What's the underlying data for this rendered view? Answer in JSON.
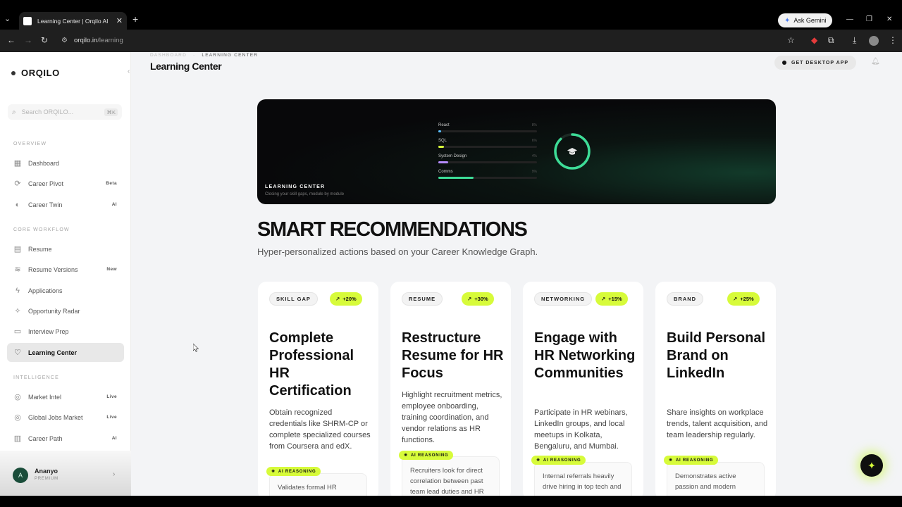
{
  "browser": {
    "tab_title": "Learning Center | Orqilo AI",
    "url_host": "orqilo.in",
    "url_path": "/learning",
    "ask_gemini": "Ask Gemini"
  },
  "sidebar": {
    "brand": "ORQILO",
    "search_placeholder": "Search ORQILO...",
    "search_shortcut": "⌘K",
    "sections": {
      "overview": "OVERVIEW",
      "core": "CORE WORKFLOW",
      "intelligence": "INTELLIGENCE"
    },
    "items": [
      {
        "label": "Dashboard",
        "badge": ""
      },
      {
        "label": "Career Pivot",
        "badge": "Beta"
      },
      {
        "label": "Career Twin",
        "badge": "AI"
      },
      {
        "label": "Resume",
        "badge": ""
      },
      {
        "label": "Resume Versions",
        "badge": "New"
      },
      {
        "label": "Applications",
        "badge": ""
      },
      {
        "label": "Opportunity Radar",
        "badge": ""
      },
      {
        "label": "Interview Prep",
        "badge": ""
      },
      {
        "label": "Learning Center",
        "badge": ""
      },
      {
        "label": "Market Intel",
        "badge": "Live"
      },
      {
        "label": "Global Jobs Market",
        "badge": "Live"
      },
      {
        "label": "Career Path",
        "badge": "AI"
      }
    ],
    "user": {
      "initial": "A",
      "name": "Ananyo",
      "plan": "PREMIUM"
    }
  },
  "header": {
    "crumb_root": "DASHBOARD",
    "crumb_sep": "·",
    "crumb_current": "LEARNING CENTER",
    "title": "Learning Center",
    "desktop_button": "GET DESKTOP APP"
  },
  "hero": {
    "label": "LEARNING CENTER",
    "subtitle": "Closing your skill gaps, module by module",
    "skills": [
      {
        "name": "React",
        "percent": "8%",
        "value": 0.03,
        "color": "#5bc0ff"
      },
      {
        "name": "SQL",
        "percent": "6%",
        "value": 0.06,
        "color": "#d7fb3a"
      },
      {
        "name": "System Design",
        "percent": "4%",
        "value": 0.1,
        "color": "#b68cff"
      },
      {
        "name": "Comms",
        "percent": "9%",
        "value": 0.36,
        "color": "#3ddc97"
      }
    ],
    "ring_value": 0.88,
    "ring_color": "#3ddc97"
  },
  "recommendations": {
    "title": "SMART RECOMMENDATIONS",
    "subtitle": "Hyper-personalized actions based on your Career Knowledge Graph.",
    "ai_label": "AI REASONING",
    "cards": [
      {
        "category": "SKILL GAP",
        "impact": "+20%",
        "title": "Complete Professional HR Certification",
        "description": "Obtain recognized credentials like SHRM-CP or complete specialized courses from Coursera and edX.",
        "reasoning": "Validates formal HR"
      },
      {
        "category": "RESUME",
        "impact": "+30%",
        "title": "Restructure Resume for HR Focus",
        "description": "Highlight recruitment metrics, employee onboarding, training coordination, and vendor relations as HR functions.",
        "reasoning": "Recruiters look for direct correlation between past team lead duties and HR"
      },
      {
        "category": "NETWORKING",
        "impact": "+15%",
        "title": "Engage with HR Networking Communities",
        "description": "Participate in HR webinars, LinkedIn groups, and local meetups in Kolkata, Bengaluru, and Mumbai.",
        "reasoning": "Internal referrals heavily drive hiring in top tech and"
      },
      {
        "category": "BRAND",
        "impact": "+25%",
        "title": "Build Personal Brand on LinkedIn",
        "description": "Share insights on workplace trends, talent acquisition, and team leadership regularly.",
        "reasoning": "Demonstrates active passion and modern"
      }
    ]
  }
}
